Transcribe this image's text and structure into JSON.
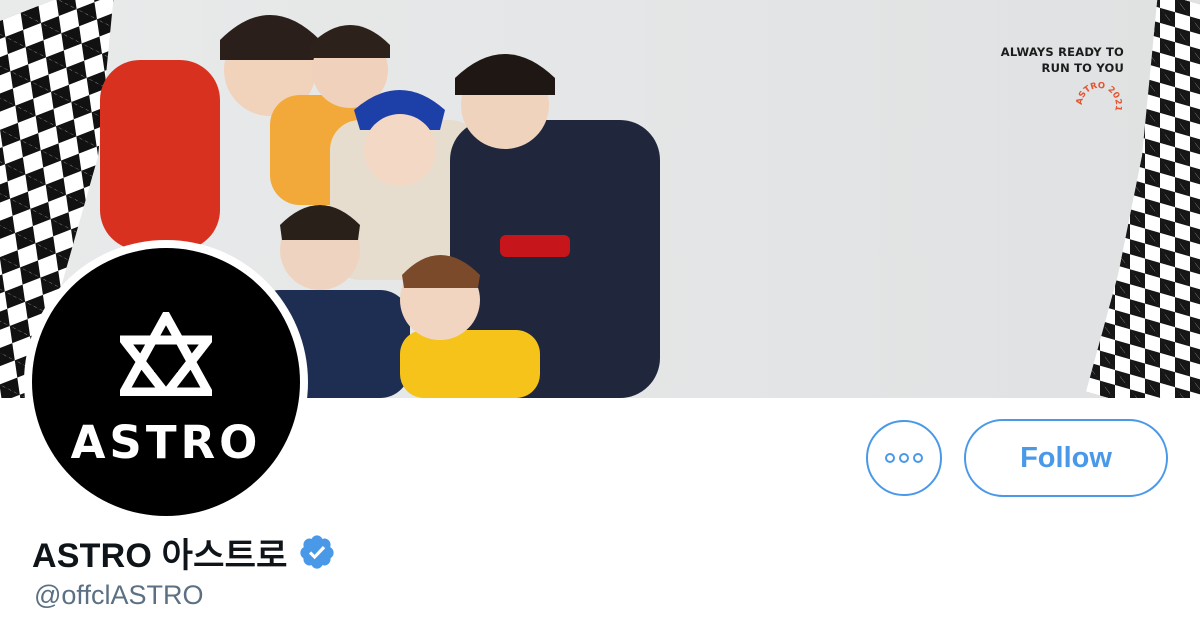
{
  "banner": {
    "caption_line1": "ALWAYS READY TO",
    "caption_line2": "RUN TO YOU",
    "stamp_text": "ASTRO 2021"
  },
  "avatar": {
    "wordmark": "ASTRO"
  },
  "profile": {
    "display_name": "ASTRO 아스트로",
    "handle": "@offclASTRO",
    "verified": true
  },
  "actions": {
    "more_icon": "more-options-icon",
    "follow_label": "Follow"
  },
  "colors": {
    "accent": "#4a99e9",
    "text_primary": "#0f1419",
    "text_secondary": "#5b7083",
    "verified_badge": "#4a99e9"
  }
}
